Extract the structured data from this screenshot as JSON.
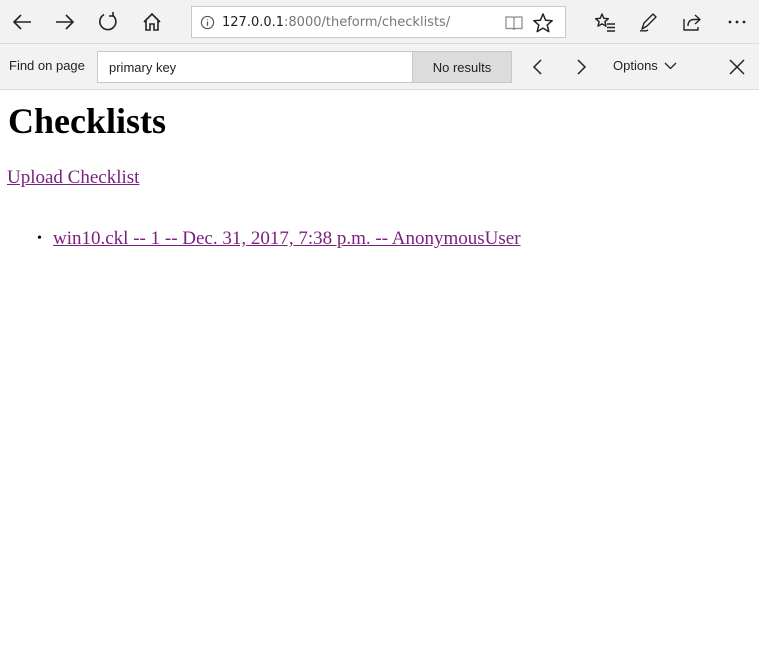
{
  "browser": {
    "url_host": "127.0.0.1",
    "url_rest": ":8000/theform/checklists/",
    "icons": [
      "back-icon",
      "forward-icon",
      "refresh-icon",
      "home-icon",
      "info-icon",
      "reading-view-icon",
      "favorite-star-icon",
      "favorites-hub-icon",
      "pen-icon",
      "share-icon",
      "more-icon"
    ]
  },
  "find": {
    "label": "Find on page",
    "query": "primary key",
    "result": "No results",
    "options_label": "Options"
  },
  "page": {
    "title": "Checklists",
    "upload_link": "Upload Checklist",
    "items": [
      {
        "text": "win10.ckl -- 1 -- Dec. 31, 2017, 7:38 p.m. -- AnonymousUser"
      }
    ]
  }
}
